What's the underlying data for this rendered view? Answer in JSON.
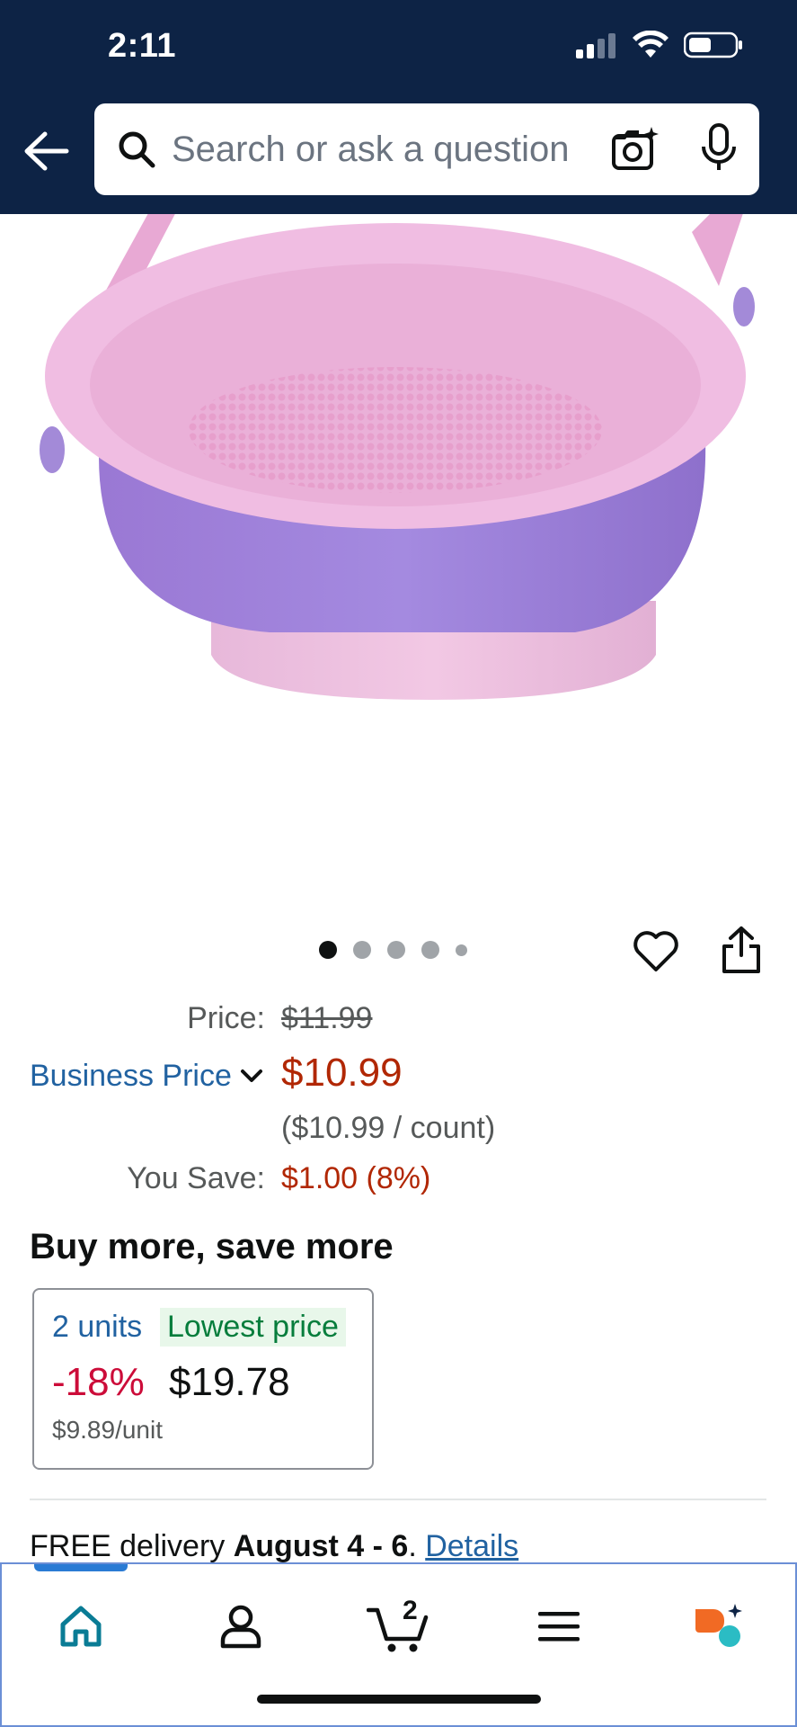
{
  "status_bar": {
    "time": "2:11"
  },
  "search": {
    "placeholder": "Search or ask a question"
  },
  "carousel": {
    "total": 5,
    "active_index": 0
  },
  "price": {
    "label": "Price:",
    "list_price": "$11.99",
    "business_label": "Business Price",
    "sale_price": "$10.99",
    "unit_price": "($10.99 / count)",
    "save_label": "You Save:",
    "save_value": "$1.00 (8%)"
  },
  "bulk": {
    "title": "Buy more, save more",
    "units": "2 units",
    "badge": "Lowest price",
    "discount": "-18%",
    "price": "$19.78",
    "per_unit": "$9.89/unit"
  },
  "delivery": {
    "prefix": "FREE delivery",
    "dates": "August 4 - 6",
    "suffix": ". ",
    "link": "Details"
  },
  "nav": {
    "cart_count": "2"
  },
  "colors": {
    "header_bg": "#0d2345",
    "price_red": "#b12704",
    "link_blue": "#2162a1",
    "badge_green": "#067d3c"
  }
}
